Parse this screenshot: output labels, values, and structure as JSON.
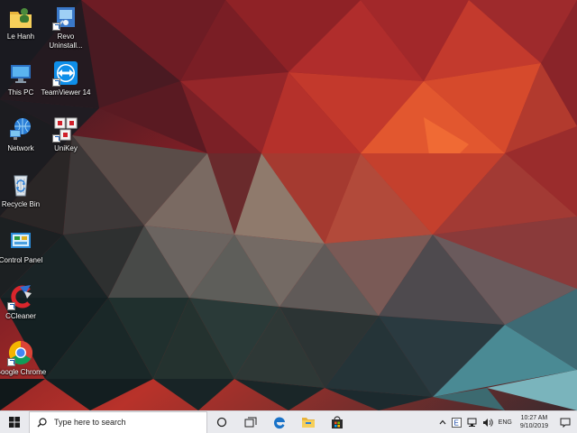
{
  "desktop": {
    "icons": [
      {
        "label": "Le Hanh"
      },
      {
        "label": "Revo Uninstall..."
      },
      {
        "label": "This PC"
      },
      {
        "label": "TeamViewer 14"
      },
      {
        "label": "Network"
      },
      {
        "label": "UniKey"
      },
      {
        "label": "Recycle Bin"
      },
      {
        "label": "Control Panel"
      },
      {
        "label": "CCleaner"
      },
      {
        "label": "Google Chrome"
      }
    ]
  },
  "taskbar": {
    "search_placeholder": "Type here to search",
    "pinned": [
      "task-view",
      "edge",
      "file-explorer",
      "store"
    ],
    "tray": {
      "language": "ENG",
      "time": "10:27 AM",
      "date": "9/10/2019"
    }
  },
  "colors": {
    "taskbar_bg": "#e9eaee",
    "accent_blue": "#0078d7"
  }
}
